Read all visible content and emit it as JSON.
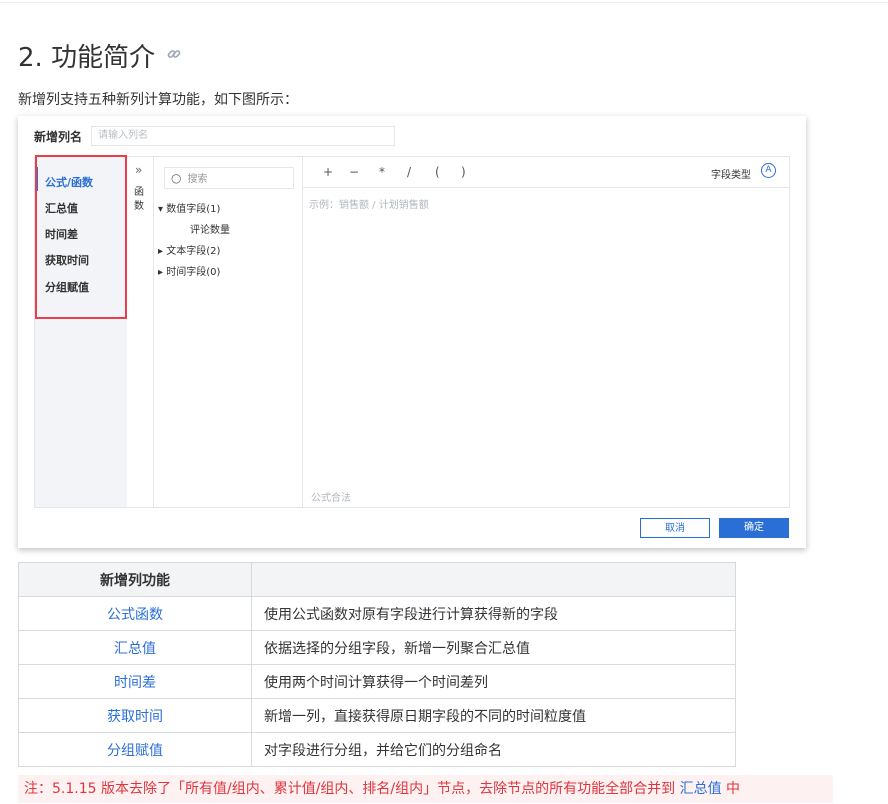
{
  "section": {
    "heading": "2. 功能简介",
    "link_icon": "link-icon"
  },
  "intro": "新增列支持五种新列计算功能，如下图所示：",
  "dialog": {
    "name_label": "新增列名",
    "name_placeholder": "请输入列名",
    "nav": [
      "公式/函数",
      "汇总值",
      "时间差",
      "获取时间",
      "分组赋值"
    ],
    "fn_strip": {
      "expand_icon": "double-chevron-right-icon",
      "label_1": "函",
      "label_2": "数"
    },
    "search_placeholder": "搜索",
    "tree": {
      "numeric": "数值字段(1)",
      "numeric_child": "评论数量",
      "text": "文本字段(2)",
      "time": "时间字段(0)"
    },
    "operators": [
      "+",
      "−",
      "*",
      "/",
      "(",
      ")"
    ],
    "field_type_label": "字段类型",
    "field_type_icon": "A",
    "example": "示例：销售额 / 计划销售额",
    "syntax": "公式合法",
    "cancel": "取消",
    "ok": "确定"
  },
  "table": {
    "header": [
      "新增列功能",
      ""
    ],
    "rows": [
      [
        "公式函数",
        "使用公式函数对原有字段进行计算获得新的字段"
      ],
      [
        "汇总值",
        "依据选择的分组字段，新增一列聚合汇总值"
      ],
      [
        "时间差",
        "使用两个时间计算获得一个时间差列"
      ],
      [
        "获取时间",
        "新增一列，直接获得原日期字段的不同的时间粒度值"
      ],
      [
        "分组赋值",
        "对字段进行分组，并给它们的分组命名"
      ]
    ]
  },
  "note": {
    "text_before": "注：5.1.15 版本去除了「所有值/组内、累计值/组内、排名/组内」节点，去除节点的所有功能全部合并到 ",
    "link": "汇总值",
    "text_after": " 中"
  },
  "colors": {
    "accent": "#2b6fd6",
    "highlight_box": "#e8404a",
    "note_bg": "#fdf1f1",
    "note_text": "#e0353f"
  }
}
